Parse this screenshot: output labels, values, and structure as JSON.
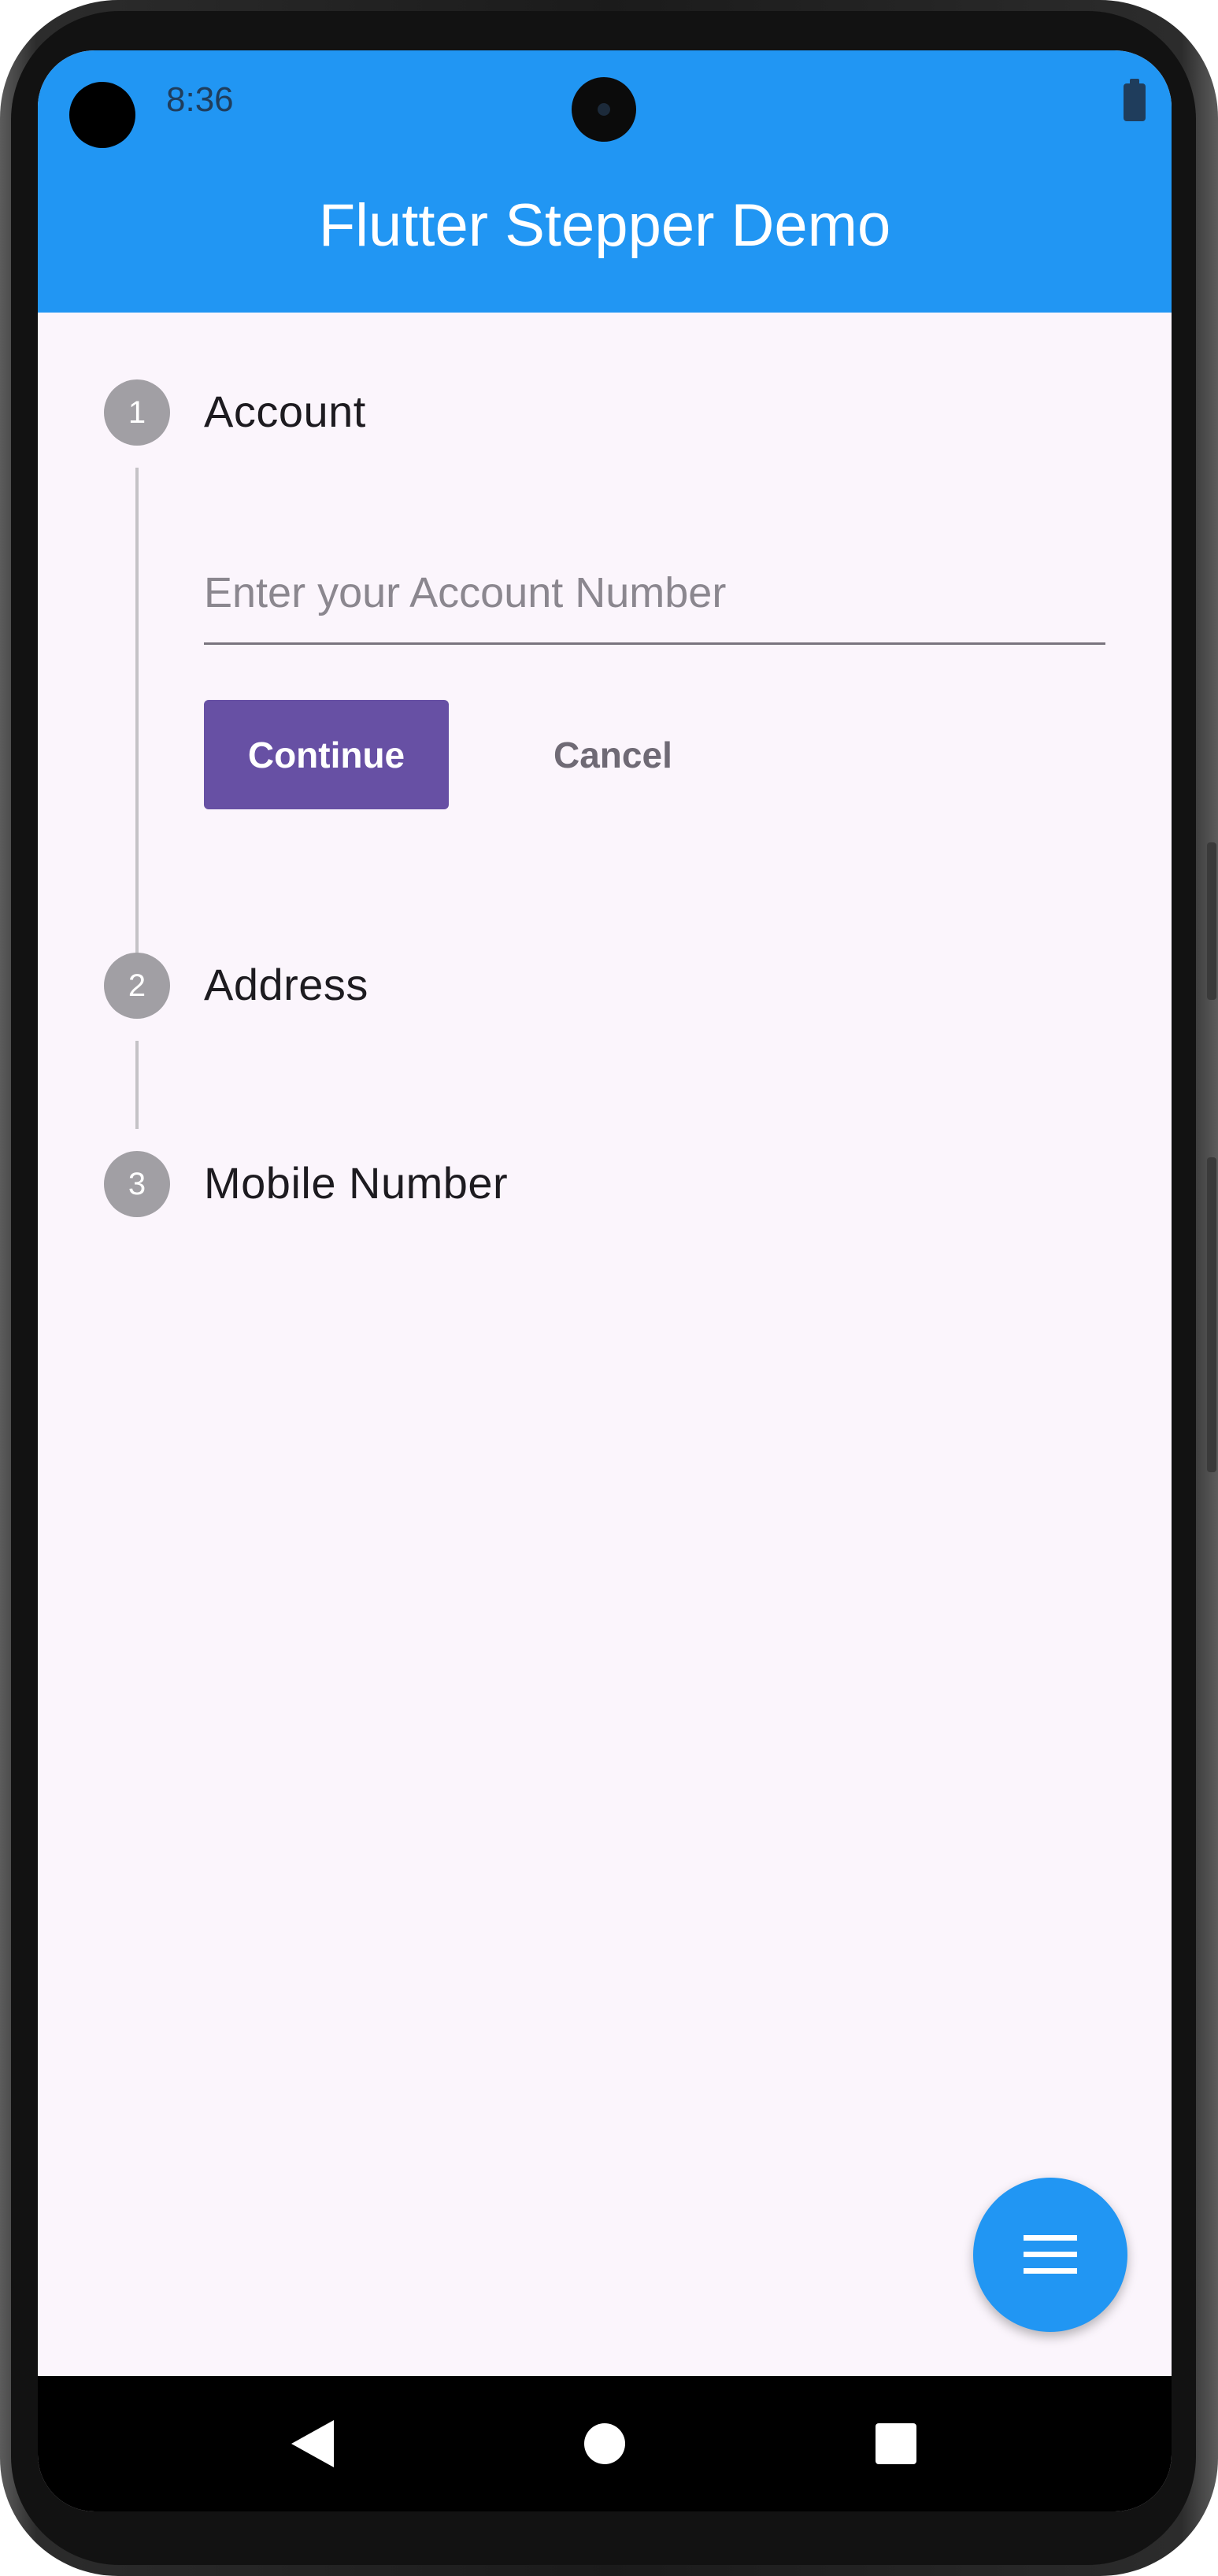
{
  "status_bar": {
    "time": "8:36"
  },
  "app_bar": {
    "title": "Flutter Stepper Demo"
  },
  "stepper": {
    "steps": [
      {
        "number": "1",
        "title": "Account",
        "active": true
      },
      {
        "number": "2",
        "title": "Address",
        "active": false
      },
      {
        "number": "3",
        "title": "Mobile Number",
        "active": false
      }
    ],
    "account_input": {
      "placeholder": "Enter your Account Number",
      "value": ""
    },
    "continue_label": "Continue",
    "cancel_label": "Cancel"
  },
  "fab": {
    "icon": "menu-icon"
  },
  "navigation_bar": {
    "icons": [
      "back-icon",
      "home-icon",
      "recents-icon"
    ]
  },
  "colors": {
    "primary": "#2196f3",
    "button": "#6750a4",
    "background": "#fbf5fc",
    "step_inactive": "#a19fa4"
  }
}
